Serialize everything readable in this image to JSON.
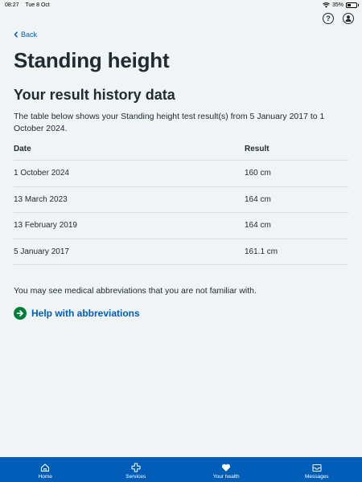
{
  "status_bar": {
    "time": "08:27",
    "date": "Tue 8 Oct",
    "battery": "35%",
    "battery_level": 0.35
  },
  "header": {
    "help_icon": "help-icon",
    "account_icon": "account-icon"
  },
  "back_label": "Back",
  "title": "Standing height",
  "section_title": "Your result history data",
  "intro": "The table below shows your Standing height test result(s) from 5 January 2017 to 1 October 2024.",
  "table": {
    "headers": {
      "date": "Date",
      "result": "Result"
    },
    "rows": [
      {
        "date": "1 October 2024",
        "result": "160 cm"
      },
      {
        "date": "13 March 2023",
        "result": "164 cm"
      },
      {
        "date": "13 February 2019",
        "result": "164 cm"
      },
      {
        "date": "5 January 2017",
        "result": "161.1 cm"
      }
    ]
  },
  "abbrev_text": "You may see medical abbreviations that you are not familiar with.",
  "help_link": "Help with abbreviations",
  "tabs": [
    {
      "label": "Home",
      "icon": "home-icon"
    },
    {
      "label": "Services",
      "icon": "services-icon"
    },
    {
      "label": "Your health",
      "icon": "heart-icon"
    },
    {
      "label": "Messages",
      "icon": "messages-icon"
    }
  ],
  "colors": {
    "accent": "#005eb8",
    "link_arrow": "#007f3b",
    "background": "#f0f4f5",
    "text": "#212b32"
  }
}
